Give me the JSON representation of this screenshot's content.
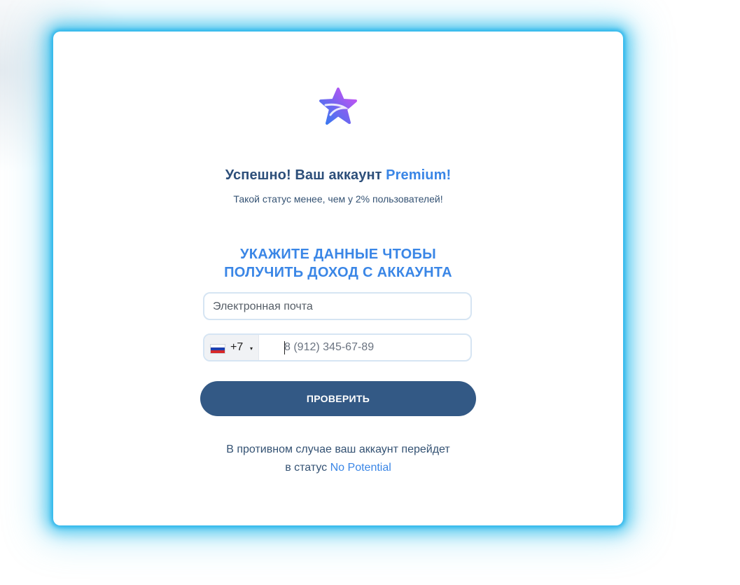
{
  "logo": {
    "icon": "star-logo-icon",
    "colors": [
      "#c04bf5",
      "#3a86e6"
    ]
  },
  "headline": {
    "text": "Успешно! Ваш аккаунт ",
    "accent": "Premium!"
  },
  "subline": "Такой статус менее, чем у 2% пользователей!",
  "cta_title": {
    "line1": "УКАЖИТЕ ДАННЫЕ ЧТОБЫ",
    "line2": "ПОЛУЧИТЬ ДОХОД С АККАУНТА"
  },
  "email": {
    "placeholder": "Электронная почта",
    "value": ""
  },
  "phone": {
    "country_flag": "russia-flag-icon",
    "country_code": "+7",
    "caret": "▾",
    "placeholder": "8 (912) 345-67-89",
    "value": ""
  },
  "submit_label": "ПРОВЕРИТЬ",
  "footer": {
    "line1": "В противном случае ваш аккаунт перейдет",
    "line2_prefix": "в статус ",
    "status_link": "No Potential"
  },
  "colors": {
    "accent": "#3a86e6",
    "button": "#335985",
    "text": "#2d4f7a",
    "glow": "#28b4eb"
  }
}
